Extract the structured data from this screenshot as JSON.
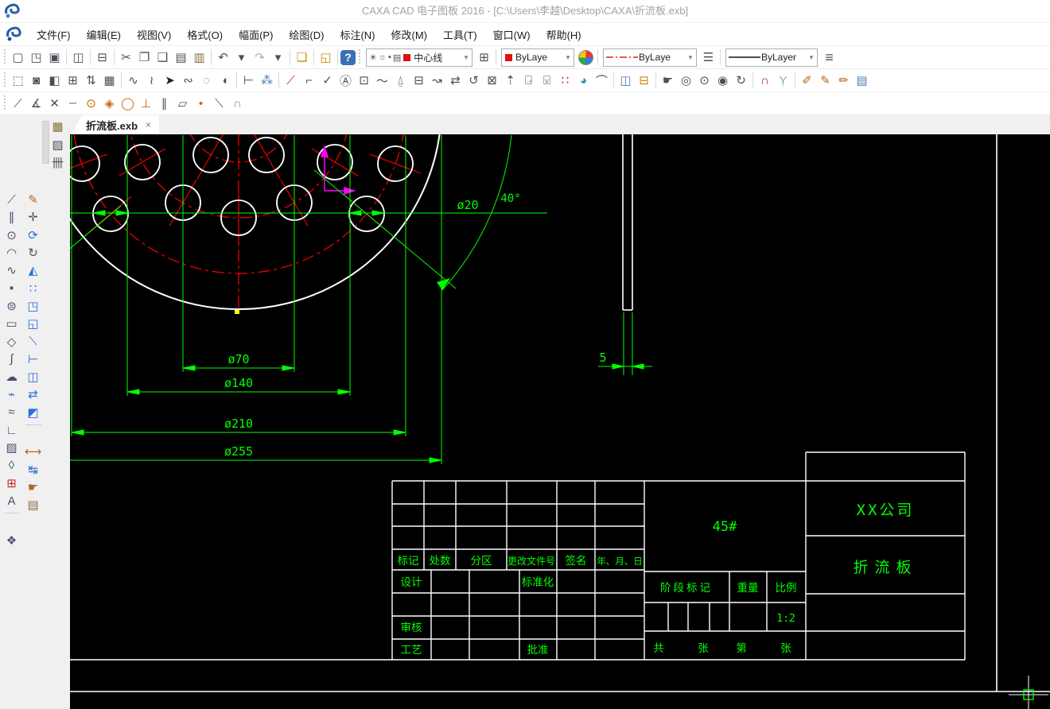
{
  "window": {
    "title": "CAXA CAD 电子图板 2016 - [C:\\Users\\李越\\Desktop\\CAXA\\折流板.exb]"
  },
  "menu": {
    "items": [
      {
        "n": "menu-file",
        "t": "文件(F)"
      },
      {
        "n": "menu-edit",
        "t": "编辑(E)"
      },
      {
        "n": "menu-view",
        "t": "视图(V)"
      },
      {
        "n": "menu-format",
        "t": "格式(O)"
      },
      {
        "n": "menu-sheet",
        "t": "幅面(P)"
      },
      {
        "n": "menu-draw",
        "t": "绘图(D)"
      },
      {
        "n": "menu-dimension",
        "t": "标注(N)"
      },
      {
        "n": "menu-modify",
        "t": "修改(M)"
      },
      {
        "n": "menu-tools",
        "t": "工具(T)"
      },
      {
        "n": "menu-window",
        "t": "窗口(W)"
      },
      {
        "n": "menu-help",
        "t": "帮助(H)"
      }
    ]
  },
  "toolbar1": {
    "file_icons": [
      {
        "n": "new-file-icon",
        "g": "▢"
      },
      {
        "n": "open-file-icon",
        "g": "◳"
      },
      {
        "n": "save-icon",
        "g": "▣"
      },
      {
        "n": "sep",
        "g": ""
      },
      {
        "n": "save-as-icon",
        "g": "◫"
      },
      {
        "n": "sep",
        "g": ""
      },
      {
        "n": "print-icon",
        "g": "⊟"
      },
      {
        "n": "sep",
        "g": ""
      },
      {
        "n": "cut-icon",
        "g": "✂"
      },
      {
        "n": "copy-icon",
        "g": "❐"
      },
      {
        "n": "copy-basepoint-icon",
        "g": "❑"
      },
      {
        "n": "paste-icon",
        "g": "▤"
      },
      {
        "n": "paste-special-icon",
        "g": "▥",
        "c": "#8a6d3b"
      },
      {
        "n": "sep",
        "g": ""
      },
      {
        "n": "undo-icon",
        "g": "↶"
      },
      {
        "n": "undo-dropdown",
        "g": "▾"
      },
      {
        "n": "redo-icon",
        "g": "↷",
        "c": "#aab2bd"
      },
      {
        "n": "redo-dropdown",
        "g": "▾"
      },
      {
        "n": "sep",
        "g": ""
      },
      {
        "n": "format-painter-icon",
        "g": "❏",
        "c": "#c7860f"
      },
      {
        "n": "sep",
        "g": ""
      },
      {
        "n": "ole-insert-icon",
        "g": "◱",
        "c": "#c7860f"
      }
    ],
    "layer_combo": {
      "value": "中心线"
    },
    "color_combo": {
      "value": "ByLaye"
    },
    "linetype_combo": {
      "value": "ByLaye"
    },
    "lineweight_combo": {
      "value": "ByLayer"
    }
  },
  "toolbar2": {
    "icons": [
      {
        "n": "zoom-extents-icon",
        "g": "⬚"
      },
      {
        "n": "named-view-icon",
        "g": "◙"
      },
      {
        "n": "split-window-icon",
        "g": "◧"
      },
      {
        "n": "grid-window-icon",
        "g": "⊞"
      },
      {
        "n": "display-order-icon",
        "g": "⇅"
      },
      {
        "n": "text-window-icon",
        "g": "▦"
      },
      {
        "n": "sep",
        "g": ""
      },
      {
        "n": "wave-line-icon",
        "g": "∿"
      },
      {
        "n": "polyline-icon",
        "g": "≀"
      },
      {
        "n": "pointer-icon",
        "g": "➤",
        "c": "#222"
      },
      {
        "n": "lasso-select-icon",
        "g": "∾"
      },
      {
        "n": "circle-select-icon",
        "g": "◌",
        "c": "#4a77b5"
      },
      {
        "n": "cylinder-icon",
        "g": "◖"
      },
      {
        "n": "sep",
        "g": ""
      },
      {
        "n": "linear-dim-icon",
        "g": "⊢"
      },
      {
        "n": "node-edit-icon",
        "g": "⁂",
        "c": "#4a77b5"
      },
      {
        "n": "sep",
        "g": ""
      },
      {
        "n": "trim-red-icon",
        "g": "⟋",
        "c": "#c22"
      },
      {
        "n": "fillet-text-icon",
        "g": "⌐"
      },
      {
        "n": "check-icon",
        "g": "✓"
      },
      {
        "n": "text-annotate-icon",
        "g": "Ⓐ"
      },
      {
        "n": "tolerance-icon",
        "g": "⊡"
      },
      {
        "n": "leader-icon",
        "g": "〜"
      },
      {
        "n": "datum-icon",
        "g": "⍙"
      },
      {
        "n": "coord-dim-icon",
        "g": "⊟"
      },
      {
        "n": "curve-dim-icon",
        "g": "↝"
      },
      {
        "n": "move-text-icon",
        "g": "⇄"
      },
      {
        "n": "rotate-text-icon",
        "g": "↺"
      },
      {
        "n": "box-text-icon",
        "g": "⊠"
      },
      {
        "n": "arrow-dim-icon",
        "g": "⇡"
      },
      {
        "n": "stamp-dim-icon",
        "g": "⍈"
      },
      {
        "n": "surface-finish-icon",
        "g": "⍌"
      },
      {
        "n": "grid-points-icon",
        "g": "∷",
        "c": "#c22"
      },
      {
        "n": "quadrant-circle-icon",
        "g": "◕",
        "c": "#2a9aa8"
      },
      {
        "n": "arc-dim-icon",
        "g": "⌒"
      },
      {
        "n": "sep",
        "g": ""
      },
      {
        "n": "properties-window-icon",
        "g": "◫",
        "c": "#4a77b5"
      },
      {
        "n": "ruler-icon",
        "g": "⊟",
        "c": "#c7860f"
      },
      {
        "n": "sep",
        "g": ""
      },
      {
        "n": "pan-icon",
        "g": "☛"
      },
      {
        "n": "zoom-in-icon",
        "g": "◎"
      },
      {
        "n": "zoom-window-icon",
        "g": "⊙"
      },
      {
        "n": "zoom-all-icon",
        "g": "◉"
      },
      {
        "n": "zoom-previous-icon",
        "g": "↻"
      },
      {
        "n": "sep",
        "g": ""
      },
      {
        "n": "snap-magnet-icon",
        "g": "∩",
        "c": "#993333"
      },
      {
        "n": "filter-icon",
        "g": "Ỵ",
        "c": "#6db3dd"
      },
      {
        "n": "sep",
        "g": ""
      },
      {
        "n": "dim-brush-icon",
        "g": "✐",
        "c": "#b5651d"
      },
      {
        "n": "text-brush-icon",
        "g": "✎",
        "c": "#b5651d"
      },
      {
        "n": "node-brush-icon",
        "g": "✏",
        "c": "#b5651d"
      },
      {
        "n": "edit-notes-icon",
        "g": "▤",
        "c": "#4a77b5"
      }
    ]
  },
  "toolbar3": {
    "icons": [
      {
        "n": "snap-endpoint-icon",
        "g": "⟋"
      },
      {
        "n": "snap-midpoint-icon",
        "g": "∡"
      },
      {
        "n": "snap-intersection-icon",
        "g": "✕"
      },
      {
        "n": "snap-extension-icon",
        "g": "┄"
      },
      {
        "n": "snap-center-icon",
        "g": "⊙",
        "c": "#c60"
      },
      {
        "n": "snap-quadrant-icon",
        "g": "◈",
        "c": "#c60"
      },
      {
        "n": "snap-tangent-icon",
        "g": "◯",
        "c": "#c60"
      },
      {
        "n": "snap-perpendicular-icon",
        "g": "⊥",
        "c": "#c60"
      },
      {
        "n": "snap-parallel-icon",
        "g": "∥"
      },
      {
        "n": "snap-shape-icon",
        "g": "▱"
      },
      {
        "n": "snap-point-icon",
        "g": "•",
        "c": "#c60"
      },
      {
        "n": "snap-node-icon",
        "g": "⟍"
      },
      {
        "n": "snap-off-icon",
        "g": "∩",
        "c": "#8a8f98"
      }
    ]
  },
  "leftpanel": {
    "top_icons": [
      {
        "n": "titleblock-lib-icon",
        "g": "▦",
        "c": "#8a6d3b"
      },
      {
        "n": "hatch-lib-icon",
        "g": "▨"
      },
      {
        "n": "grid-lib-icon",
        "g": "卌"
      }
    ],
    "draw_icons": [
      {
        "n": "line-tool",
        "g": "⟋"
      },
      {
        "n": "parallel-tool",
        "g": "∥"
      },
      {
        "n": "circle-tool",
        "g": "⊙"
      },
      {
        "n": "arc-tool",
        "g": "◠"
      },
      {
        "n": "spline-tool",
        "g": "∿"
      },
      {
        "n": "point-tool",
        "g": "▪"
      },
      {
        "n": "ellipse-tool",
        "g": "⊜"
      },
      {
        "n": "rectangle-tool",
        "g": "▭"
      },
      {
        "n": "polygon-tool",
        "g": "◇"
      },
      {
        "n": "s-curve-tool",
        "g": "∫"
      },
      {
        "n": "cloud-tool",
        "g": "☁"
      },
      {
        "n": "centerline-tool",
        "g": "⌁",
        "c": "#2a6fd6"
      },
      {
        "n": "wave-tool",
        "g": "≈"
      },
      {
        "n": "axis-tool",
        "g": "∟"
      },
      {
        "n": "hatch-tool",
        "g": "▨"
      },
      {
        "n": "profile-tool",
        "g": "◊"
      },
      {
        "n": "table-tool",
        "g": "⊞",
        "c": "#c22"
      },
      {
        "n": "text-tool",
        "g": "A"
      },
      {
        "n": "sep-h",
        "g": ""
      },
      {
        "n": "block-tool",
        "g": "❖"
      }
    ],
    "modify_icons": [
      {
        "n": "erase-tool",
        "g": "✎",
        "c": "#b5651d"
      },
      {
        "n": "move-tool",
        "g": "✛"
      },
      {
        "n": "rotate-copy-tool",
        "g": "⟳",
        "c": "#2a6fd6"
      },
      {
        "n": "rotate-tool",
        "g": "↻"
      },
      {
        "n": "mirror-tool",
        "g": "◭",
        "c": "#2a6fd6"
      },
      {
        "n": "array-tool",
        "g": "∷",
        "c": "#2a6fd6"
      },
      {
        "n": "corner-tool",
        "g": "◳",
        "c": "#2a6fd6"
      },
      {
        "n": "scale-tool",
        "g": "◱",
        "c": "#2a6fd6"
      },
      {
        "n": "trim-tool",
        "g": "⟍",
        "c": "#2a6fd6"
      },
      {
        "n": "extend-tool",
        "g": "⊢",
        "c": "#2a6fd6"
      },
      {
        "n": "stretch-tool",
        "g": "◫",
        "c": "#2a6fd6"
      },
      {
        "n": "shift-tool",
        "g": "⇄",
        "c": "#2a6fd6"
      },
      {
        "n": "solid-tool",
        "g": "◩",
        "c": "#2a6fd6"
      },
      {
        "n": "sep-h",
        "g": ""
      },
      {
        "n": "dim-tool",
        "g": "⟷",
        "c": "#b5651d"
      },
      {
        "n": "dim-chain-tool",
        "g": "↹",
        "c": "#2a6fd6"
      },
      {
        "n": "pick-tool",
        "g": "☛",
        "c": "#b5651d"
      },
      {
        "n": "stamp-tool",
        "g": "▤",
        "c": "#8a6d3b"
      }
    ]
  },
  "tab": {
    "label": "折流板.exb",
    "close": "×"
  },
  "drawing": {
    "dim_labels": {
      "d20": "ø20",
      "a40": "40°",
      "d70": "ø70",
      "d140": "ø140",
      "d210": "ø210",
      "d255": "ø255",
      "t5": "5"
    },
    "colors": {
      "geometry": "#ffffff",
      "dimension": "#00ff00",
      "centerline": "#ff0000",
      "axes": "#ff00ff",
      "marker": "#ffff00"
    }
  },
  "title_block": {
    "header_row": {
      "c1": "标记",
      "c2": "处数",
      "c3": "分区",
      "c4": "更改文件号",
      "c5": "签名",
      "c6": "年、月、日"
    },
    "labels": {
      "design": "设计",
      "standard": "标准化",
      "audit": "审核",
      "process": "工艺",
      "approve": "批准"
    },
    "material": "45#",
    "stage_mark": "阶段标记",
    "weight": "重量",
    "scale_label": "比例",
    "scale_value": "1:2",
    "sheet_row": {
      "total": "共",
      "sheets": "张",
      "no": "第",
      "sheet": "张"
    },
    "company": "XX公司",
    "part_name": "折流板"
  }
}
